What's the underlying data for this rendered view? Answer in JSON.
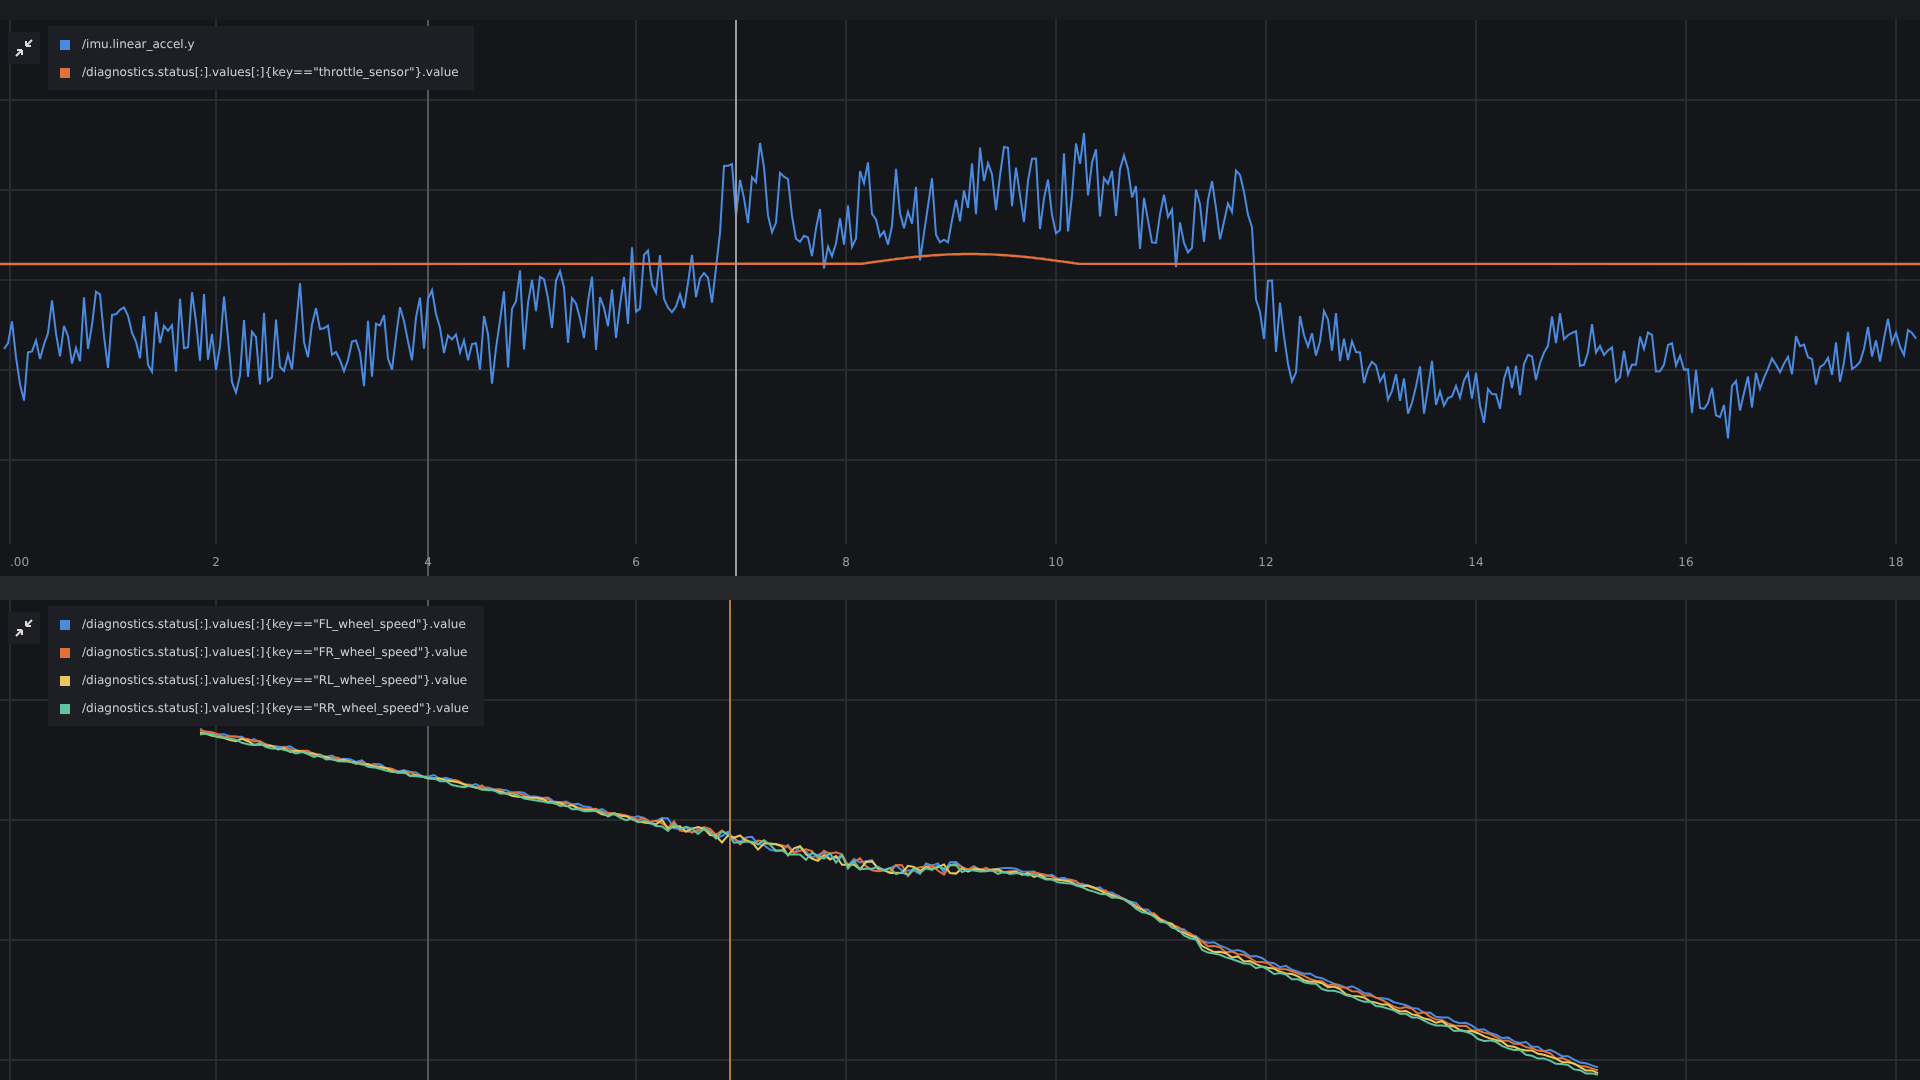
{
  "panels": [
    {
      "legend": [
        {
          "label": "/imu.linear_accel.y",
          "color": "#4a8be0"
        },
        {
          "label": "/diagnostics.status[:].values[:]{key==\"throttle_sensor\"}.value",
          "color": "#e0713a"
        }
      ],
      "x_ticks": [
        ".00",
        "2",
        "4",
        "6",
        "8",
        "10",
        "12",
        "14",
        "16",
        "18"
      ]
    },
    {
      "legend": [
        {
          "label": "/diagnostics.status[:].values[:]{key==\"FL_wheel_speed\"}.value",
          "color": "#4a8be0"
        },
        {
          "label": "/diagnostics.status[:].values[:]{key==\"FR_wheel_speed\"}.value",
          "color": "#e0713a"
        },
        {
          "label": "/diagnostics.status[:].values[:]{key==\"RL_wheel_speed\"}.value",
          "color": "#e8c85a"
        },
        {
          "label": "/diagnostics.status[:].values[:]{key==\"RR_wheel_speed\"}.value",
          "color": "#5fc4a0"
        }
      ]
    }
  ]
}
